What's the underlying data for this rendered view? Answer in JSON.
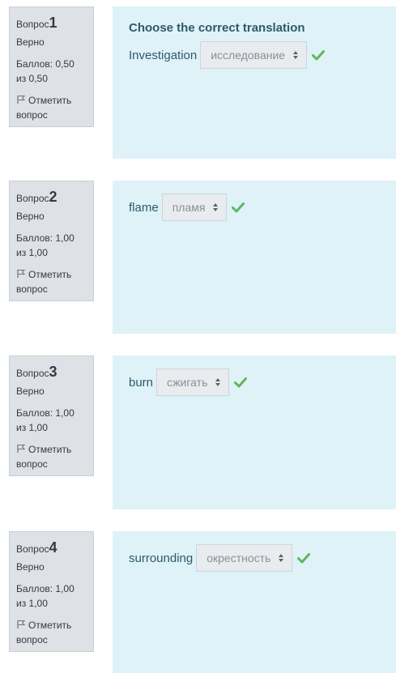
{
  "questions": [
    {
      "label": "Вопрос",
      "number": "1",
      "state": "Верно",
      "grade": "Баллов: 0,50 из 0,50",
      "flag_text": "Отметить вопрос",
      "question_text": "Choose the correct translation",
      "word": "Investigation",
      "selected": "исследование",
      "status_icon": "check-icon"
    },
    {
      "label": "Вопрос",
      "number": "2",
      "state": "Верно",
      "grade": "Баллов: 1,00 из 1,00",
      "flag_text": "Отметить вопрос",
      "word": "flame",
      "selected": "пламя",
      "status_icon": "check-icon"
    },
    {
      "label": "Вопрос",
      "number": "3",
      "state": "Верно",
      "grade": "Баллов: 1,00 из 1,00",
      "flag_text": "Отметить вопрос",
      "word": "burn",
      "selected": "сжигать",
      "status_icon": "check-icon"
    },
    {
      "label": "Вопрос",
      "number": "4",
      "state": "Верно",
      "grade": "Баллов: 1,00 из 1,00",
      "flag_text": "Отметить вопрос",
      "word": "surrounding",
      "selected": "окрестность",
      "status_icon": "check-icon"
    }
  ],
  "colors": {
    "info_bg": "#dee2e6",
    "content_bg": "#def2f8",
    "text_teal": "#2f5a68",
    "check_green": "#5cb85c"
  }
}
